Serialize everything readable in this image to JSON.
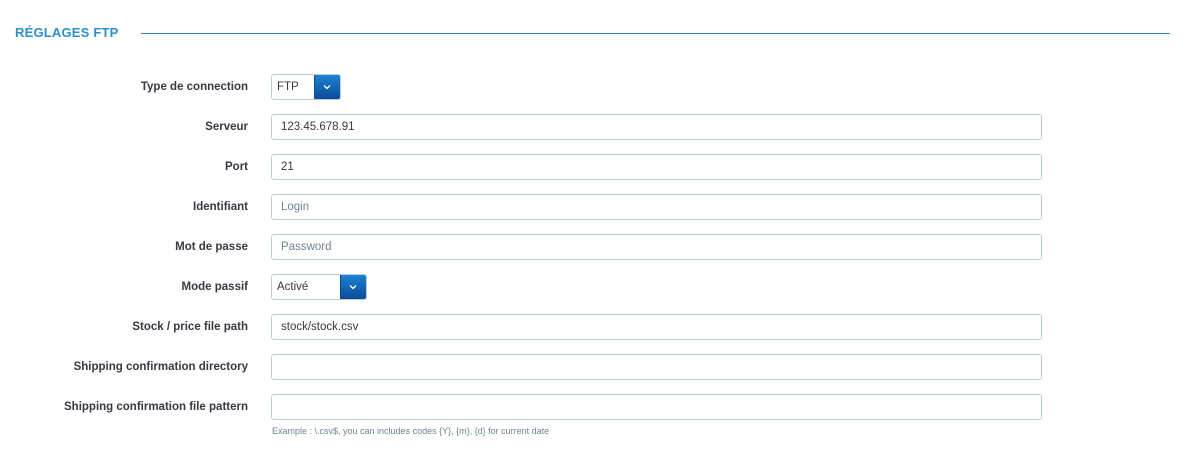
{
  "section": {
    "title": "RÉGLAGES FTP"
  },
  "fields": {
    "connection_type": {
      "label": "Type de connection",
      "value": "FTP"
    },
    "server": {
      "label": "Serveur",
      "value": "123.45.678.91"
    },
    "port": {
      "label": "Port",
      "value": "21"
    },
    "login": {
      "label": "Identifiant",
      "placeholder": "Login"
    },
    "password": {
      "label": "Mot de passe",
      "placeholder": "Password"
    },
    "passive_mode": {
      "label": "Mode passif",
      "value": "Activé"
    },
    "stock_path": {
      "label": "Stock / price file path",
      "value": "stock/stock.csv"
    },
    "shipping_dir": {
      "label": "Shipping confirmation directory",
      "value": ""
    },
    "shipping_pattern": {
      "label": "Shipping confirmation file pattern",
      "value": "",
      "help": "Example : \\.csv$, you can includes codes {Y}, {m}, {d} for current date"
    }
  },
  "icons": {
    "dropdown": "chevron-down-icon"
  },
  "colors": {
    "accent": "#2b8fc9",
    "select_button": "#0a4a99",
    "input_border": "#bbcdd2"
  }
}
